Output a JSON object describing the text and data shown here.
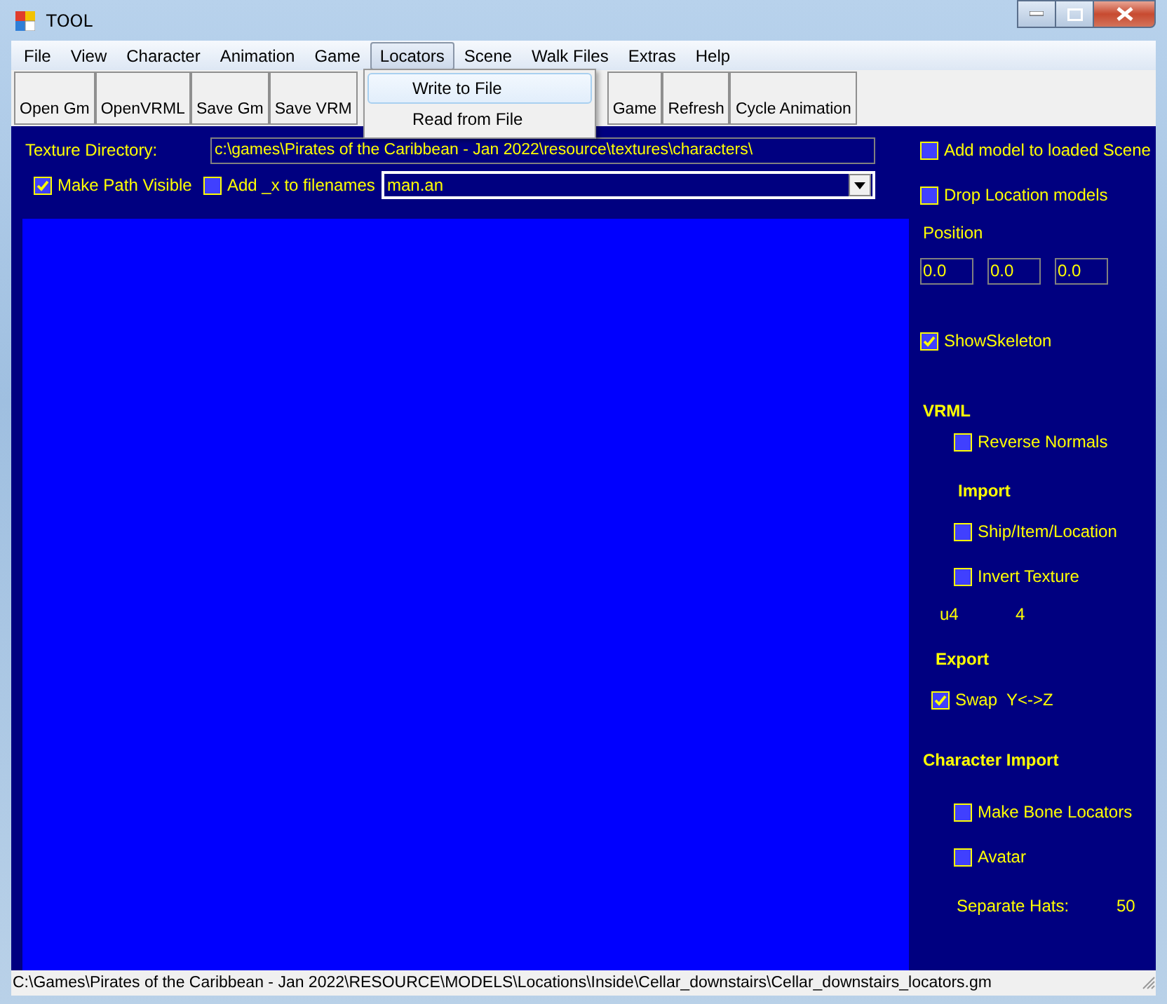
{
  "window": {
    "title": "TOOL"
  },
  "menu": [
    {
      "label": "File",
      "selected": false
    },
    {
      "label": "View",
      "selected": false
    },
    {
      "label": "Character",
      "selected": false
    },
    {
      "label": "Animation",
      "selected": false
    },
    {
      "label": "Game",
      "selected": false
    },
    {
      "label": "Locators",
      "selected": true
    },
    {
      "label": "Scene",
      "selected": false
    },
    {
      "label": "Walk Files",
      "selected": false
    },
    {
      "label": "Extras",
      "selected": false
    },
    {
      "label": "Help",
      "selected": false
    }
  ],
  "open_menu": [
    {
      "label": "Write to File",
      "selected": true
    },
    {
      "label": "Read from File",
      "selected": false
    }
  ],
  "toolbar_left": [
    "Open Gm",
    "OpenVRML",
    "Save Gm",
    "Save VRM"
  ],
  "toolbar_right": [
    "Game",
    "Refresh",
    "Cycle Animation"
  ],
  "texture_directory": {
    "label": "Texture Directory:",
    "value": "c:\\games\\Pirates of the Caribbean - Jan 2022\\resource\\textures\\characters\\"
  },
  "options": [
    {
      "label": "Make Path Visible",
      "checked": true
    },
    {
      "label": "Add _x to filenames",
      "checked": false
    }
  ],
  "file_combo": {
    "value": "man.an"
  },
  "side_panel": [
    {
      "kind": "checkbox",
      "label": "Add model to loaded Scene",
      "checked": false
    },
    {
      "kind": "checkbox",
      "label": "Drop Location models",
      "checked": false
    },
    {
      "kind": "label",
      "label": "Position"
    },
    {
      "kind": "fields",
      "values": [
        "0.0",
        "0.0",
        "0.0"
      ]
    },
    {
      "kind": "checkbox",
      "label": "ShowSkeleton",
      "checked": true
    },
    {
      "kind": "heading",
      "label": "VRML"
    },
    {
      "kind": "checkbox",
      "label": "Reverse Normals",
      "checked": false
    },
    {
      "kind": "heading",
      "label": "Import"
    },
    {
      "kind": "checkbox",
      "label": "Ship/Item/Location",
      "checked": false
    },
    {
      "kind": "checkbox",
      "label": "Invert Texture",
      "checked": false
    },
    {
      "kind": "pair",
      "label": "u4",
      "value": "4"
    },
    {
      "kind": "heading",
      "label": "Export"
    },
    {
      "kind": "checkbox",
      "label": "Swap  Y<->Z",
      "checked": true
    },
    {
      "kind": "heading",
      "label": "Character Import"
    },
    {
      "kind": "checkbox",
      "label": "Make Bone Locators",
      "checked": false
    },
    {
      "kind": "checkbox",
      "label": "Avatar",
      "checked": false
    },
    {
      "kind": "pair",
      "label": "Separate Hats:",
      "value": "50"
    }
  ],
  "status_bar": "C:\\Games\\Pirates of the Caribbean - Jan 2022\\RESOURCE\\MODELS\\Locations\\Inside\\Cellar_downstairs\\Cellar_downstairs_locators.gm"
}
